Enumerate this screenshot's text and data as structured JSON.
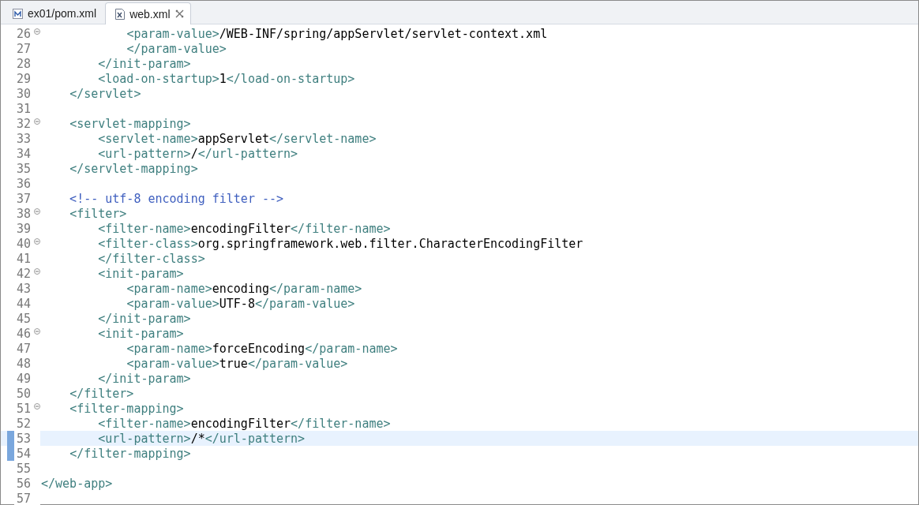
{
  "tabs": [
    {
      "label": "ex01/pom.xml",
      "selected": false,
      "kind": "maven",
      "closable": false
    },
    {
      "label": "web.xml",
      "selected": true,
      "kind": "xml",
      "closable": true
    }
  ],
  "lines": [
    {
      "number": "26",
      "foldable": true,
      "current": false,
      "changed": false,
      "kind": "code",
      "text": "            <param-value>/WEB-INF/spring/appServlet/servlet-context.xml"
    },
    {
      "number": "27",
      "foldable": false,
      "current": false,
      "changed": false,
      "kind": "code",
      "text": "            </param-value>"
    },
    {
      "number": "28",
      "foldable": false,
      "current": false,
      "changed": false,
      "kind": "code",
      "text": "        </init-param>"
    },
    {
      "number": "29",
      "foldable": false,
      "current": false,
      "changed": false,
      "kind": "code",
      "text": "        <load-on-startup>1</load-on-startup>"
    },
    {
      "number": "30",
      "foldable": false,
      "current": false,
      "changed": false,
      "kind": "code",
      "text": "    </servlet>"
    },
    {
      "number": "31",
      "foldable": false,
      "current": false,
      "changed": false,
      "kind": "code"
    },
    {
      "number": "32",
      "foldable": true,
      "current": false,
      "changed": false,
      "kind": "code",
      "text": "    <servlet-mapping>"
    },
    {
      "number": "33",
      "foldable": false,
      "current": false,
      "changed": false,
      "kind": "code",
      "text": "        <servlet-name>appServlet</servlet-name>"
    },
    {
      "number": "34",
      "foldable": false,
      "current": false,
      "changed": false,
      "kind": "code",
      "text": "        <url-pattern>/</url-pattern>"
    },
    {
      "number": "35",
      "foldable": false,
      "current": false,
      "changed": false,
      "kind": "code",
      "text": "    </servlet-mapping>"
    },
    {
      "number": "36",
      "foldable": false,
      "current": false,
      "changed": false,
      "kind": "code"
    },
    {
      "number": "37",
      "foldable": false,
      "current": false,
      "changed": false,
      "kind": "comment",
      "text": "    <!-- utf-8 encoding filter -->"
    },
    {
      "number": "38",
      "foldable": true,
      "current": false,
      "changed": false,
      "kind": "code",
      "text": "    <filter>"
    },
    {
      "number": "39",
      "foldable": false,
      "current": false,
      "changed": false,
      "kind": "code",
      "text": "        <filter-name>encodingFilter</filter-name>"
    },
    {
      "number": "40",
      "foldable": true,
      "current": false,
      "changed": false,
      "kind": "code",
      "text": "        <filter-class>org.springframework.web.filter.CharacterEncodingFilter"
    },
    {
      "number": "41",
      "foldable": false,
      "current": false,
      "changed": false,
      "kind": "code",
      "text": "        </filter-class>"
    },
    {
      "number": "42",
      "foldable": true,
      "current": false,
      "changed": false,
      "kind": "code",
      "text": "        <init-param>"
    },
    {
      "number": "43",
      "foldable": false,
      "current": false,
      "changed": false,
      "kind": "code",
      "text": "            <param-name>encoding</param-name>"
    },
    {
      "number": "44",
      "foldable": false,
      "current": false,
      "changed": false,
      "kind": "code",
      "text": "            <param-value>UTF-8</param-value>"
    },
    {
      "number": "45",
      "foldable": false,
      "current": false,
      "changed": false,
      "kind": "code",
      "text": "        </init-param>"
    },
    {
      "number": "46",
      "foldable": true,
      "current": false,
      "changed": false,
      "kind": "code",
      "text": "        <init-param>"
    },
    {
      "number": "47",
      "foldable": false,
      "current": false,
      "changed": false,
      "kind": "code",
      "text": "            <param-name>forceEncoding</param-name>"
    },
    {
      "number": "48",
      "foldable": false,
      "current": false,
      "changed": false,
      "kind": "code",
      "text": "            <param-value>true</param-value>"
    },
    {
      "number": "49",
      "foldable": false,
      "current": false,
      "changed": false,
      "kind": "code",
      "text": "        </init-param>"
    },
    {
      "number": "50",
      "foldable": false,
      "current": false,
      "changed": false,
      "kind": "code",
      "text": "    </filter>"
    },
    {
      "number": "51",
      "foldable": true,
      "current": false,
      "changed": false,
      "kind": "code",
      "text": "    <filter-mapping>"
    },
    {
      "number": "52",
      "foldable": false,
      "current": false,
      "changed": false,
      "kind": "code",
      "text": "        <filter-name>encodingFilter</filter-name>"
    },
    {
      "number": "53",
      "foldable": false,
      "current": true,
      "changed": true,
      "kind": "code",
      "text": "        <url-pattern>/*</url-pattern>"
    },
    {
      "number": "54",
      "foldable": false,
      "current": false,
      "changed": true,
      "kind": "code",
      "text": "    </filter-mapping>"
    },
    {
      "number": "55",
      "foldable": false,
      "current": false,
      "changed": false,
      "kind": "code"
    },
    {
      "number": "56",
      "foldable": false,
      "current": false,
      "changed": false,
      "kind": "code",
      "text": "</web-app>"
    },
    {
      "number": "57",
      "foldable": false,
      "current": false,
      "changed": false,
      "kind": "code"
    }
  ]
}
